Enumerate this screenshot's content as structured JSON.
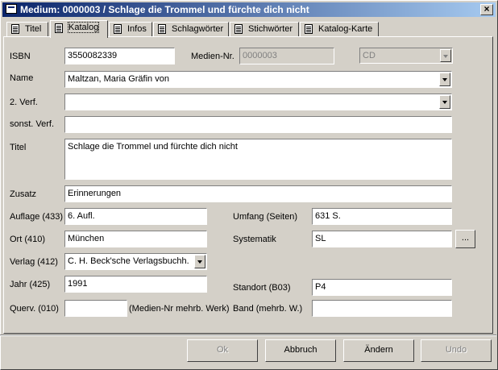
{
  "window": {
    "title": "Medium: 0000003 / Schlage die Trommel und fürchte dich nicht",
    "close_label": "×"
  },
  "tabs": [
    {
      "label": "Titel"
    },
    {
      "label": "Katalog"
    },
    {
      "label": "Infos"
    },
    {
      "label": "Schlagwörter"
    },
    {
      "label": "Stichwörter"
    },
    {
      "label": "Katalog-Karte"
    }
  ],
  "form": {
    "isbn": {
      "label": "ISBN",
      "value": "3550082339"
    },
    "mediennr": {
      "label": "Medien-Nr.",
      "value": "0000003"
    },
    "medientyp": {
      "value": "CD"
    },
    "name": {
      "label": "Name",
      "value": "Maltzan, Maria Gräfin von"
    },
    "verf2": {
      "label": "2. Verf.",
      "value": ""
    },
    "sonst_verf": {
      "label": "sonst. Verf.",
      "value": ""
    },
    "titel": {
      "label": "Titel",
      "value": "Schlage die Trommel und fürchte dich nicht"
    },
    "zusatz": {
      "label": "Zusatz",
      "value": "Erinnerungen"
    },
    "auflage": {
      "label": "Auflage (433)",
      "value": "6. Aufl."
    },
    "umfang": {
      "label": "Umfang (Seiten)",
      "value": "631 S."
    },
    "ort": {
      "label": "Ort (410)",
      "value": "München"
    },
    "systematik": {
      "label": "Systematik",
      "value": "SL",
      "button": "..."
    },
    "verlag": {
      "label": "Verlag (412)",
      "value": "C. H. Beck'sche Verlagsbuchh."
    },
    "jahr": {
      "label": "Jahr (425)",
      "value": "1991"
    },
    "standort": {
      "label": "Standort (B03)",
      "value": "P4"
    },
    "querv": {
      "label": "Querv. (010)",
      "value": "",
      "hint": "(Medien-Nr mehrb. Werk)"
    },
    "band": {
      "label": "Band (mehrb. W.)",
      "value": ""
    }
  },
  "buttons": {
    "ok": "Ok",
    "abbruch": "Abbruch",
    "aendern": "Ändern",
    "undo": "Undo"
  }
}
